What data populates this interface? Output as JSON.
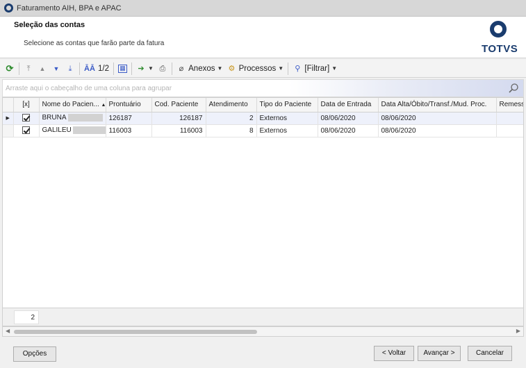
{
  "window": {
    "title": "Faturamento AIH, BPA e APAC"
  },
  "header": {
    "title": "Seleção das contas",
    "subtitle": "Selecione as contas que farão parte da fatura",
    "logo_text": "TOTVS"
  },
  "toolbar": {
    "page_indicator": "1/2",
    "anexos_label": "Anexos",
    "processos_label": "Processos",
    "filtrar_label": "[Filtrar]"
  },
  "group_panel": {
    "hint": "Arraste aqui o cabeçalho de uma coluna para agrupar"
  },
  "grid": {
    "columns": [
      "[x]",
      "Nome do Pacien...",
      "Prontuário",
      "Cod. Paciente",
      "Atendimento",
      "Tipo do Paciente",
      "Data de Entrada",
      "Data Alta/Óbito/Transf./Mud. Proc.",
      "Remessa"
    ],
    "rows": [
      {
        "selected": true,
        "checked": true,
        "nome": "BRUNA",
        "prontuario": "126187",
        "cod_paciente": "126187",
        "atendimento": "2",
        "tipo": "Externos",
        "entrada": "08/06/2020",
        "alta": "08/06/2020",
        "remessa": ""
      },
      {
        "selected": false,
        "checked": true,
        "nome": "GALILEU",
        "prontuario": "116003",
        "cod_paciente": "116003",
        "atendimento": "8",
        "tipo": "Externos",
        "entrada": "08/06/2020",
        "alta": "08/06/2020",
        "remessa": ""
      }
    ],
    "record_count": "2"
  },
  "buttons": {
    "opcoes": "Opções",
    "voltar": "< Voltar",
    "avancar": "Avançar >",
    "cancelar": "Cancelar"
  },
  "colors": {
    "brand": "#1a3c6e",
    "selected_row": "#eef1fb",
    "refresh_icon": "#2e8b2e",
    "nav_arrow": "#3b5bc7"
  }
}
